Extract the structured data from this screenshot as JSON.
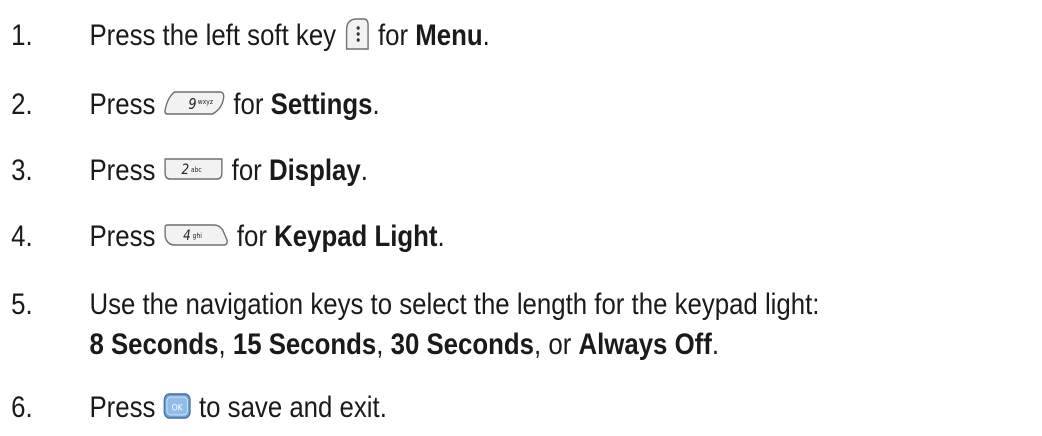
{
  "steps": [
    {
      "number": "1.",
      "pre": "Press the left soft key",
      "key_icon": "left-soft-key-icon",
      "mid": "for",
      "bold": "Menu",
      "post": "."
    },
    {
      "number": "2.",
      "pre": "Press",
      "key_icon": "key-9-wxyz-icon",
      "key_digit": "9",
      "key_letters": "wxyz",
      "mid": "for",
      "bold": "Settings",
      "post": "."
    },
    {
      "number": "3.",
      "pre": "Press",
      "key_icon": "key-2-abc-icon",
      "key_digit": "2",
      "key_letters": "abc",
      "mid": "for",
      "bold": "Display",
      "post": "."
    },
    {
      "number": "4.",
      "pre": "Press",
      "key_icon": "key-4-ghi-icon",
      "key_digit": "4",
      "key_letters": "ghi",
      "mid": "for",
      "bold": "Keypad Light",
      "post": "."
    },
    {
      "number": "5.",
      "line1": "Use the navigation keys to select the length for the keypad light:",
      "options": [
        "8 Seconds",
        "15 Seconds",
        "30 Seconds",
        "Always Off"
      ],
      "sep": ",",
      "or": "or",
      "post": "."
    },
    {
      "number": "6.",
      "pre": "Press",
      "key_icon": "ok-key-icon",
      "key_label": "OK",
      "post": "to save and exit."
    }
  ],
  "colors": {
    "text": "#1a1a1a",
    "key_outline": "#6f6f6f",
    "key_fill": "#f2f2f2",
    "ok_fill": "#6aa4dc"
  }
}
